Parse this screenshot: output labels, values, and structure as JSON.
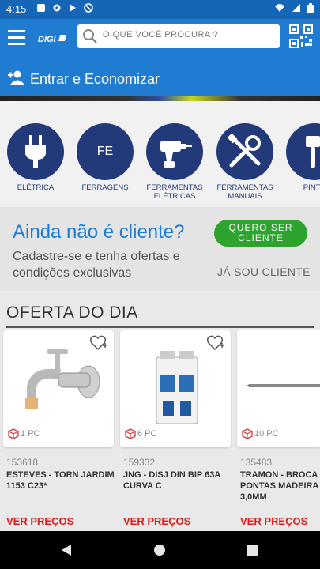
{
  "status_bar": {
    "time": "4:15"
  },
  "search": {
    "placeholder": "O QUE VOCÊ PROCURA ?"
  },
  "header": {
    "logo_text": "DIGI",
    "login_text": "Entrar e Economizar"
  },
  "categories": [
    {
      "label": "ELÉTRICA",
      "icon": "plug-icon"
    },
    {
      "label": "FERRAGENS",
      "abbr": "FE"
    },
    {
      "label": "FERRAMENTAS ELÉTRICAS",
      "icon": "drill-icon"
    },
    {
      "label": "FERRAMENTAS MANUAIS",
      "icon": "tools-icon"
    },
    {
      "label": "PINTU",
      "icon": "paint-icon"
    }
  ],
  "promo": {
    "title": "Ainda não é cliente?",
    "subtitle": "Cadastre-se e tenha ofertas e condições exclusivas",
    "cta": "QUERO SER CLIENTE",
    "login_link": "JÁ SOU CLIENTE"
  },
  "offer": {
    "title": "OFERTA DO DIA",
    "products": [
      {
        "qty": "1 PC",
        "code": "153618",
        "name": "ESTEVES - TORN JARDIM 1153 C23*",
        "price_label": "VER PREÇOS"
      },
      {
        "qty": "6 PC",
        "code": "159332",
        "name": "JNG - DISJ DIN BIP  63A CURVA C",
        "price_label": "VER PREÇOS"
      },
      {
        "qty": "10 PC",
        "code": "135483",
        "name": "TRAMON - BROCA PONTAS MADEIRA 3,0MM",
        "price_label": "VER PREÇOS"
      }
    ]
  },
  "colors": {
    "primary": "#1f7cd0",
    "category_circle": "#233a7a",
    "cta_green": "#2ea32e",
    "price_red": "#e01b1b"
  }
}
